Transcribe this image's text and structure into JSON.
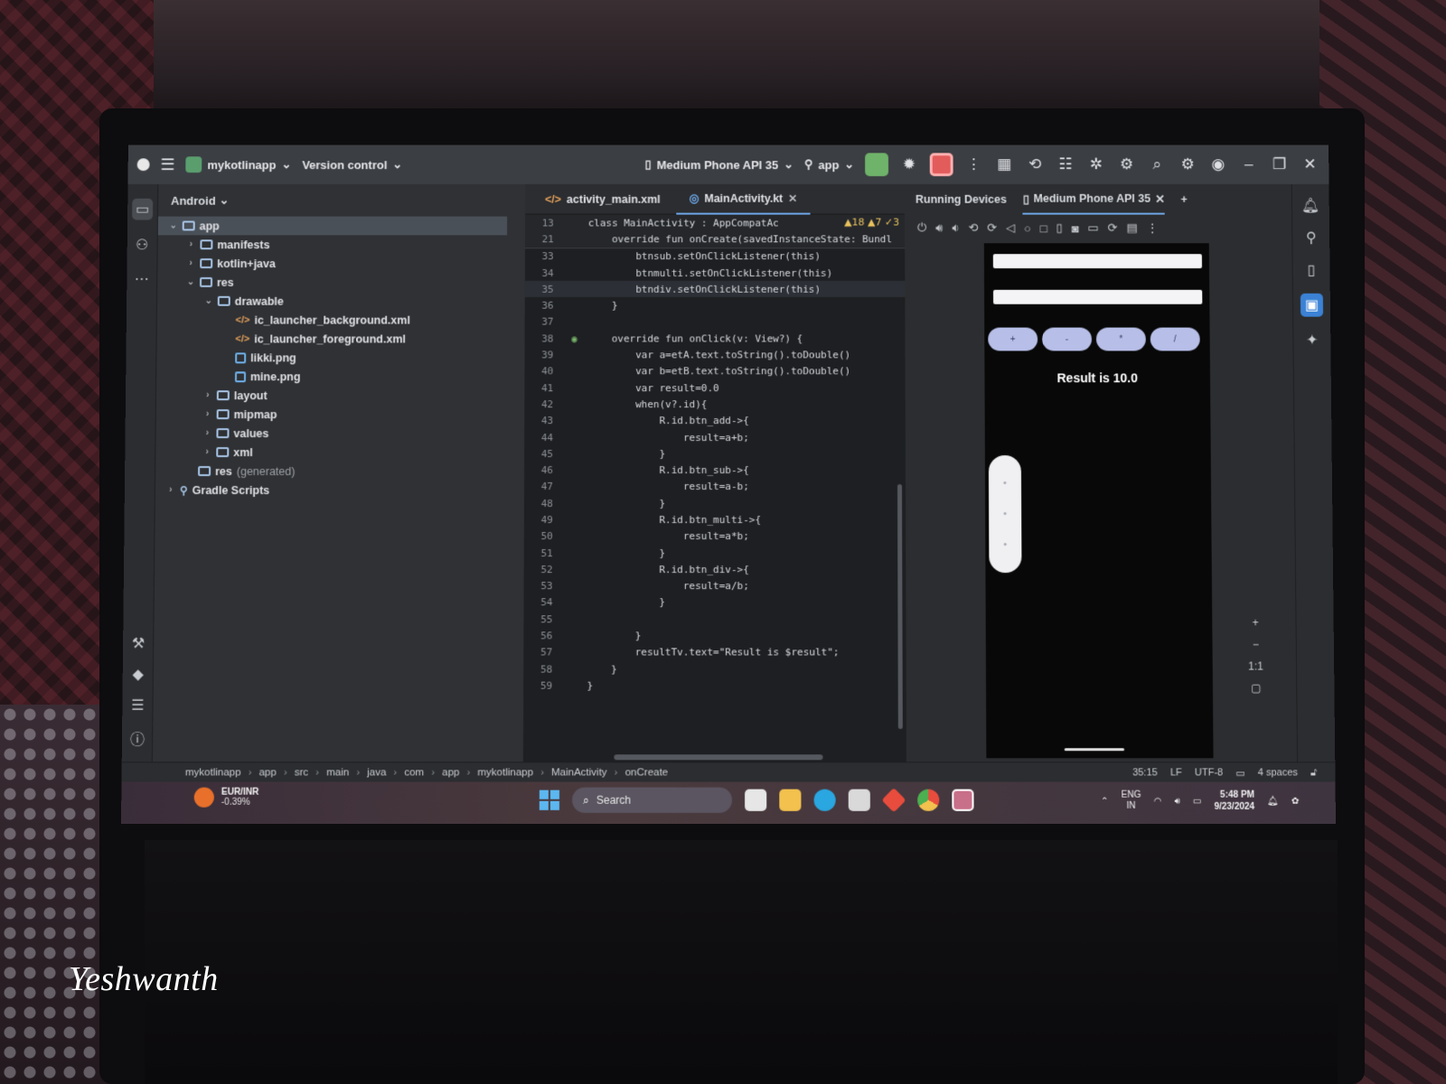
{
  "titlebar": {
    "project": "mykotlinapp",
    "vcs": "Version control",
    "device": "Medium Phone API 35",
    "config": "app"
  },
  "project_panel": {
    "view": "Android",
    "tree": [
      {
        "label": "app",
        "kind": "folder",
        "depth": 0,
        "expanded": true,
        "selected": true
      },
      {
        "label": "manifests",
        "kind": "folder",
        "depth": 1,
        "expanded": false
      },
      {
        "label": "kotlin+java",
        "kind": "folder",
        "depth": 1,
        "expanded": false
      },
      {
        "label": "res",
        "kind": "folder",
        "depth": 1,
        "expanded": true
      },
      {
        "label": "drawable",
        "kind": "folder",
        "depth": 2,
        "expanded": true
      },
      {
        "label": "ic_launcher_background.xml",
        "kind": "xml",
        "depth": 3
      },
      {
        "label": "ic_launcher_foreground.xml",
        "kind": "xml",
        "depth": 3
      },
      {
        "label": "likki.png",
        "kind": "png",
        "depth": 3
      },
      {
        "label": "mine.png",
        "kind": "png",
        "depth": 3
      },
      {
        "label": "layout",
        "kind": "folder",
        "depth": 2,
        "expanded": false
      },
      {
        "label": "mipmap",
        "kind": "folder",
        "depth": 2,
        "expanded": false
      },
      {
        "label": "values",
        "kind": "folder",
        "depth": 2,
        "expanded": false
      },
      {
        "label": "xml",
        "kind": "folder",
        "depth": 2,
        "expanded": false
      },
      {
        "label": "res",
        "suffix": "(generated)",
        "kind": "folder",
        "depth": 1
      },
      {
        "label": "Gradle Scripts",
        "kind": "gradle",
        "depth": 0,
        "expanded": false
      }
    ]
  },
  "editor": {
    "tabs": [
      {
        "label": "activity_main.xml",
        "active": false
      },
      {
        "label": "MainActivity.kt",
        "active": true
      }
    ],
    "inspections": {
      "warnings": "18",
      "weak_warnings": "7",
      "typos": "3"
    },
    "sticky_lines": [
      {
        "num": "13",
        "text": "class MainActivity : AppCompatAc"
      },
      {
        "num": "21",
        "text": "    override fun onCreate(savedInstanceState: Bundl"
      }
    ],
    "lines": [
      {
        "num": "33",
        "text": "        btnsub.setOnClickListener(this)"
      },
      {
        "num": "34",
        "text": "        btnmulti.setOnClickListener(this)"
      },
      {
        "num": "35",
        "text": "        btndiv.setOnClickListener(this)",
        "current": true
      },
      {
        "num": "36",
        "text": "    }"
      },
      {
        "num": "37",
        "text": ""
      },
      {
        "num": "38",
        "text": "    override fun onClick(v: View?) {"
      },
      {
        "num": "39",
        "text": "        var a=etA.text.toString().toDouble()"
      },
      {
        "num": "40",
        "text": "        var b=etB.text.toString().toDouble()"
      },
      {
        "num": "41",
        "text": "        var result=0.0"
      },
      {
        "num": "42",
        "text": "        when(v?.id){"
      },
      {
        "num": "43",
        "text": "            R.id.btn_add->{"
      },
      {
        "num": "44",
        "text": "                result=a+b;"
      },
      {
        "num": "45",
        "text": "            }"
      },
      {
        "num": "46",
        "text": "            R.id.btn_sub->{"
      },
      {
        "num": "47",
        "text": "                result=a-b;"
      },
      {
        "num": "48",
        "text": "            }"
      },
      {
        "num": "49",
        "text": "            R.id.btn_multi->{"
      },
      {
        "num": "50",
        "text": "                result=a*b;"
      },
      {
        "num": "51",
        "text": "            }"
      },
      {
        "num": "52",
        "text": "            R.id.btn_div->{"
      },
      {
        "num": "53",
        "text": "                result=a/b;"
      },
      {
        "num": "54",
        "text": "            }"
      },
      {
        "num": "55",
        "text": ""
      },
      {
        "num": "56",
        "text": "        }"
      },
      {
        "num": "57",
        "text": "        resultTv.text=\"Result is $result\";"
      },
      {
        "num": "58",
        "text": "    }"
      },
      {
        "num": "59",
        "text": "}"
      }
    ]
  },
  "devices": {
    "panel_title": "Running Devices",
    "tab": "Medium Phone API 35",
    "phone": {
      "buttons": [
        "+",
        "-",
        "*",
        "/"
      ],
      "result": "Result is 10.0"
    },
    "zoom_label": "1:1"
  },
  "statusbar": {
    "breadcrumb": [
      "mykotlinapp",
      "app",
      "src",
      "main",
      "java",
      "com",
      "app",
      "mykotlinapp",
      "MainActivity",
      "onCreate"
    ],
    "position": "35:15",
    "line_sep": "LF",
    "encoding": "UTF-8",
    "indent": "4 spaces"
  },
  "taskbar": {
    "weather_title": "EUR/INR",
    "weather_value": "-0.39%",
    "search": "Search",
    "lang": "ENG",
    "region": "IN",
    "time": "5:48 PM",
    "date": "9/23/2024"
  },
  "watermark": "Yeshwanth",
  "colors": {
    "ide_bg": "#2b2d30",
    "editor_bg": "#1e1f22",
    "accent": "#6fa7e8",
    "phone_button": "#b7bfe8"
  }
}
